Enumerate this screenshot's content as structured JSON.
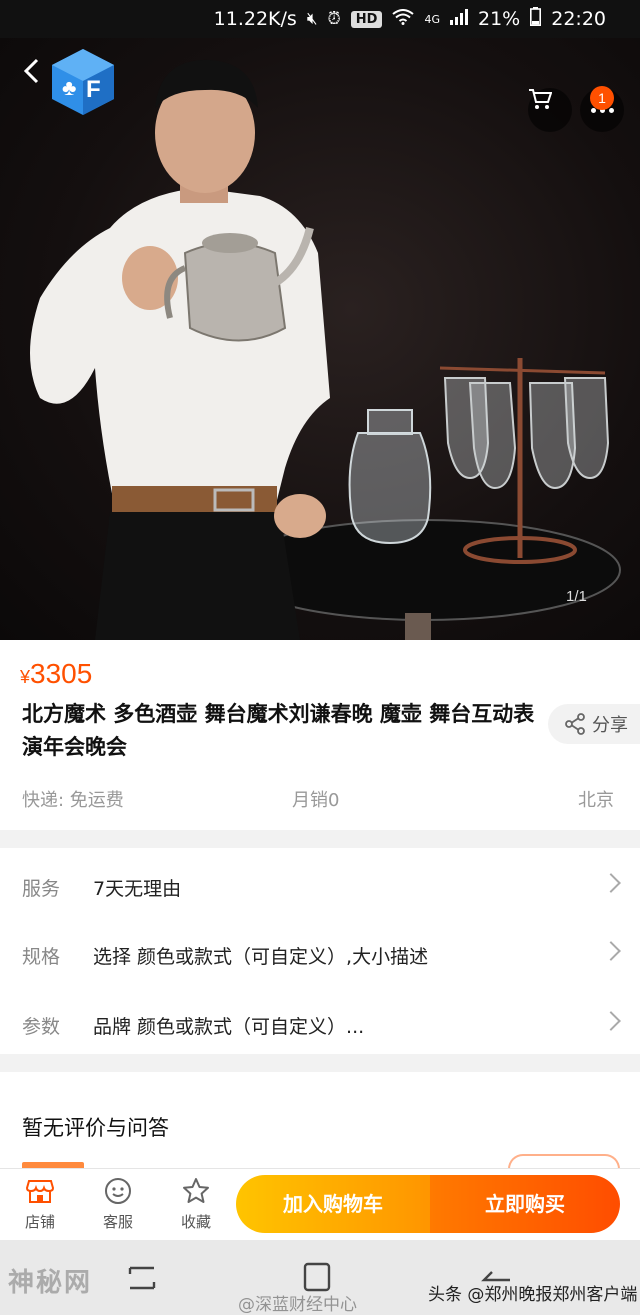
{
  "status_bar": {
    "speed": "11.22K/s",
    "hd": "HD",
    "network": "4G",
    "battery": "21%",
    "time": "22:20"
  },
  "header": {
    "cart_badge": "1"
  },
  "gallery": {
    "counter": "1/1"
  },
  "product": {
    "currency": "¥",
    "price": "3305",
    "title": "北方魔术 多色酒壶 舞台魔术刘谦春晚 魔壶 舞台互动表演年会晚会",
    "share_label": "分享",
    "shipping": "快递: 免运费",
    "monthly_sales": "月销0",
    "location": "北京"
  },
  "services": [
    {
      "label": "服务",
      "value": "7天无理由"
    },
    {
      "label": "规格",
      "value": "选择 颜色或款式（可自定义）,大小描述"
    },
    {
      "label": "参数",
      "value": "品牌 颜色或款式（可自定义）..."
    }
  ],
  "reviews": {
    "title": "暂无评价与问答"
  },
  "action_bar": {
    "shop": "店铺",
    "service": "客服",
    "favorite": "收藏",
    "add_to_cart": "加入购物车",
    "buy_now": "立即购买"
  },
  "watermarks": {
    "left": "神秘网",
    "middle": "@深蓝财经中心",
    "right": "头条 @郑州晚报郑州客户端"
  },
  "colors": {
    "accent": "#ff5000",
    "cart_gradient": "#ffc400",
    "buy_gradient": "#ff4d00"
  }
}
